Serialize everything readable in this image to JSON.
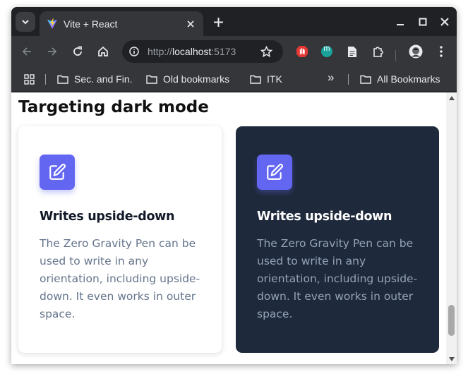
{
  "browser": {
    "tab_title": "Vite + React",
    "url_scheme": "http://",
    "url_host": "localhost",
    "url_port": ":5173",
    "bookmarks": [
      {
        "label": "Sec. and Fin."
      },
      {
        "label": "Old bookmarks"
      },
      {
        "label": "ITK"
      }
    ],
    "overflow_label": "»",
    "all_bookmarks_label": "All Bookmarks",
    "extension_badge_letter": "m"
  },
  "page": {
    "heading": "Targeting dark mode",
    "cards": [
      {
        "theme": "light",
        "title": "Writes upside-down",
        "text": "The Zero Gravity Pen can be used to write in any orientation, including upside-down. It even works in outer space."
      },
      {
        "theme": "dark",
        "title": "Writes upside-down",
        "text": "The Zero Gravity Pen can be used to write in any orientation, including upside-down. It even works in outer space."
      }
    ]
  },
  "colors": {
    "accent": "#6366f1",
    "dark_card": "#1e293b",
    "light_text": "#64748b",
    "dark_text": "#94a3b8"
  },
  "icons": {
    "card_icon": "pencil-square-icon"
  }
}
